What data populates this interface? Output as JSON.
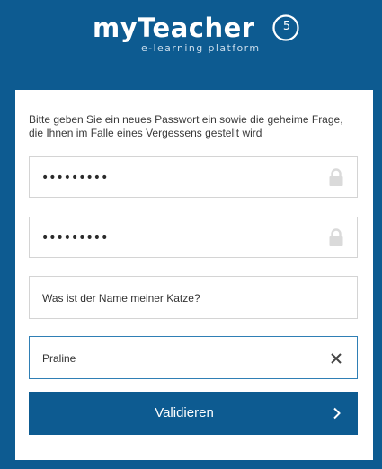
{
  "logo": {
    "title": "myTeacher",
    "version": "5",
    "subtitle": "e-learning platform"
  },
  "form": {
    "instruction": "Bitte geben Sie ein neues Passwort ein sowie die geheime Frage, die Ihnen im Falle eines Vergessens gestellt wird",
    "password": {
      "masked_value": "•••••••••",
      "icon": "lock-icon"
    },
    "password_confirm": {
      "masked_value": "•••••••••",
      "icon": "lock-icon"
    },
    "secret_question": {
      "value": "Was ist der Name meiner Katze?"
    },
    "secret_answer": {
      "value": "Praline",
      "icon": "close-icon"
    },
    "submit": {
      "label": "Validieren",
      "icon": "chevron-right-icon"
    }
  },
  "colors": {
    "brand_blue": "#0d5b91",
    "card_background": "#ffffff",
    "field_border": "#d4d4d4",
    "active_field_border": "#2f7fb5",
    "icon_gray": "#dadada"
  }
}
